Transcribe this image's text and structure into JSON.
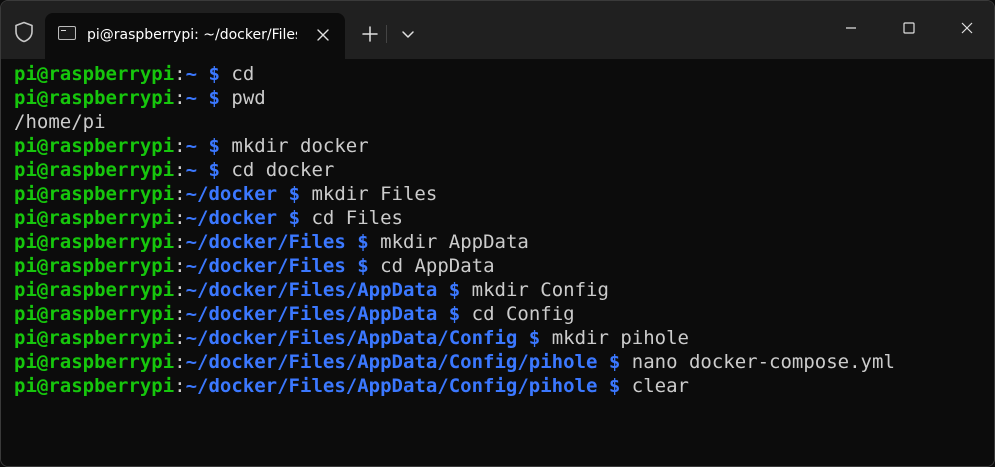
{
  "window": {
    "tab_title": "pi@raspberrypi: ~/docker/Files/AppData/Config/pihole",
    "icons": {
      "shield": "shield-icon",
      "terminal": "terminal-icon",
      "close_tab": "close-icon",
      "new_tab": "plus-icon",
      "dropdown": "chevron-down-icon",
      "minimize": "minimize-icon",
      "maximize": "maximize-icon",
      "close_window": "close-icon"
    }
  },
  "colors": {
    "user": "#16c60c",
    "path": "#3b78ff",
    "text": "#cccccc",
    "background": "#0c0c0c",
    "titlebar": "#202020"
  },
  "terminal": {
    "lines": [
      {
        "type": "prompt",
        "user": "pi@raspberrypi",
        "colon": ":",
        "path": "~",
        "dollar": "$",
        "cmd": "cd"
      },
      {
        "type": "prompt",
        "user": "pi@raspberrypi",
        "colon": ":",
        "path": "~",
        "dollar": "$",
        "cmd": "pwd"
      },
      {
        "type": "output",
        "text": "/home/pi"
      },
      {
        "type": "prompt",
        "user": "pi@raspberrypi",
        "colon": ":",
        "path": "~",
        "dollar": "$",
        "cmd": "mkdir docker"
      },
      {
        "type": "prompt",
        "user": "pi@raspberrypi",
        "colon": ":",
        "path": "~",
        "dollar": "$",
        "cmd": "cd docker"
      },
      {
        "type": "prompt",
        "user": "pi@raspberrypi",
        "colon": ":",
        "path": "~/docker",
        "dollar": "$",
        "cmd": "mkdir Files"
      },
      {
        "type": "prompt",
        "user": "pi@raspberrypi",
        "colon": ":",
        "path": "~/docker",
        "dollar": "$",
        "cmd": "cd Files"
      },
      {
        "type": "prompt",
        "user": "pi@raspberrypi",
        "colon": ":",
        "path": "~/docker/Files",
        "dollar": "$",
        "cmd": "mkdir AppData"
      },
      {
        "type": "prompt",
        "user": "pi@raspberrypi",
        "colon": ":",
        "path": "~/docker/Files",
        "dollar": "$",
        "cmd": "cd AppData"
      },
      {
        "type": "prompt",
        "user": "pi@raspberrypi",
        "colon": ":",
        "path": "~/docker/Files/AppData",
        "dollar": "$",
        "cmd": "mkdir Config"
      },
      {
        "type": "prompt",
        "user": "pi@raspberrypi",
        "colon": ":",
        "path": "~/docker/Files/AppData",
        "dollar": "$",
        "cmd": "cd Config"
      },
      {
        "type": "prompt",
        "user": "pi@raspberrypi",
        "colon": ":",
        "path": "~/docker/Files/AppData/Config",
        "dollar": "$",
        "cmd": "mkdir pihole"
      },
      {
        "type": "prompt",
        "user": "pi@raspberrypi",
        "colon": ":",
        "path": "~/docker/Files/AppData/Config/pihole",
        "dollar": "$",
        "cmd": "nano docker-compose.yml"
      },
      {
        "type": "prompt",
        "user": "pi@raspberrypi",
        "colon": ":",
        "path": "~/docker/Files/AppData/Config/pihole",
        "dollar": "$",
        "cmd": "clear"
      }
    ]
  }
}
